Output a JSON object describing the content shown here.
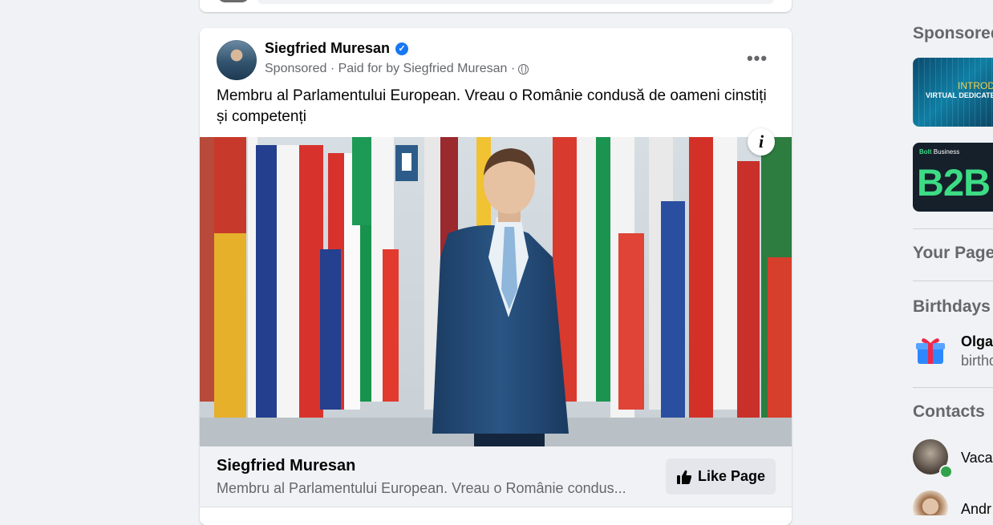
{
  "post": {
    "author": "Siegfried Muresan",
    "meta": "Sponsored · Paid for by Siegfried Muresan ·",
    "text": "Membru al Parlamentului European. Vreau o Românie condusă de oameni cinstiți și competenți",
    "cta": {
      "title": "Siegfried Muresan",
      "description": "Membru al Parlamentului European. Vreau o Românie condus...",
      "button_label": "Like Page"
    },
    "icons": {
      "verified": "verified-badge-icon",
      "globe": "globe-icon",
      "more": "more-options-icon",
      "info": "info-icon",
      "like": "thumbs-up-icon"
    }
  },
  "sidebar": {
    "sponsored_title": "Sponsored",
    "ads": [
      {
        "line1": "INTRODUC",
        "line2": "VIRTUAL DEDICATE"
      },
      {
        "line1_brand": "Bolt",
        "line1_rest": " Business",
        "line2": "B2B"
      }
    ],
    "your_pages_title": "Your Pages",
    "birthdays_title": "Birthdays",
    "birthday": {
      "name": "Olga",
      "sub": "birthd"
    },
    "contacts_title": "Contacts",
    "contacts": [
      {
        "name": "Vaca",
        "online": true
      },
      {
        "name": "Andr",
        "online": false
      }
    ]
  },
  "colors": {
    "accent": "#1877f2",
    "background": "#f0f2f5",
    "secondary_text": "#65676b",
    "online": "#31a24c",
    "bolt_green": "#3ddc84"
  }
}
